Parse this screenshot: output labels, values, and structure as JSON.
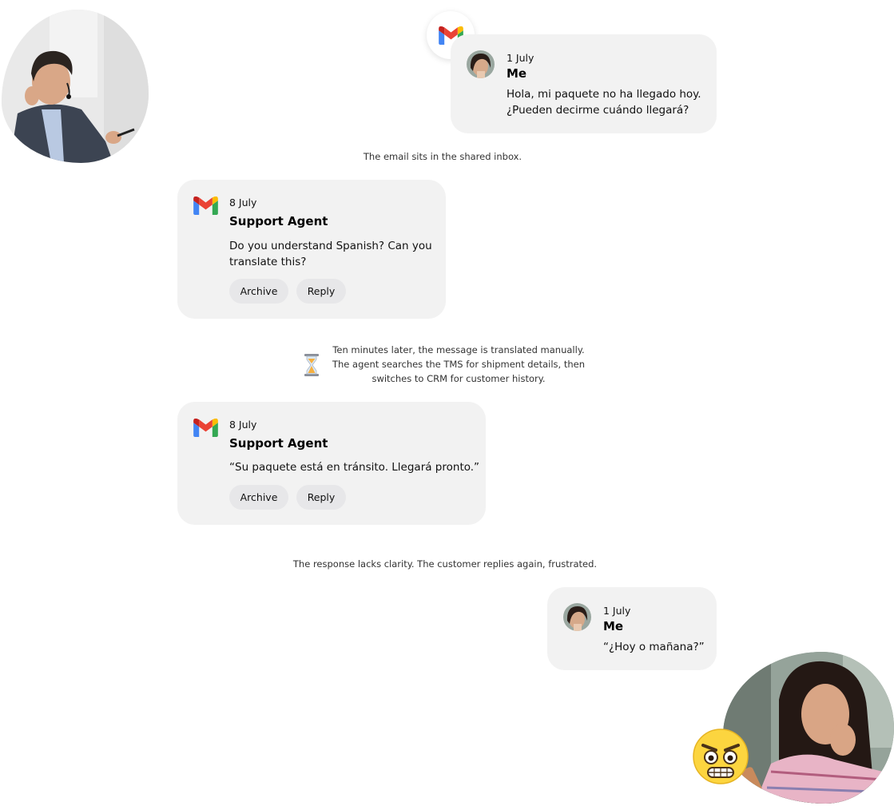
{
  "messages": [
    {
      "date": "1 July",
      "sender": "Me",
      "text": "Hola, mi paquete no ha llegado hoy. ¿Pueden decirme cuándo llegará?"
    },
    {
      "date": "8 July",
      "sender": "Support Agent",
      "text": "Do you understand Spanish? Can you translate this?",
      "archive_label": "Archive",
      "reply_label": "Reply"
    },
    {
      "date": "8 July",
      "sender": "Support Agent",
      "text": "“Su paquete está en tránsito. Llegará pronto.”",
      "archive_label": "Archive",
      "reply_label": "Reply"
    },
    {
      "date": "1 July",
      "sender": "Me",
      "text": "“¿Hoy o mañana?”"
    }
  ],
  "captions": {
    "inbox": "The email sits in the shared inbox.",
    "translated": "Ten minutes later, the message is translated manually. The agent searches the TMS for shipment details, then switches to CRM for customer history.",
    "clarity": "The response lacks clarity. The customer replies again, frustrated."
  },
  "icons": {
    "email_logo": "gmail-icon",
    "timer": "hourglass-icon",
    "frustration": "angry-face-emoji"
  },
  "colors": {
    "card_bg": "#f2f2f2",
    "button_bg": "#e7e7e9",
    "gmail_red": "#ea4335",
    "gmail_blue": "#4285f4",
    "gmail_green": "#34a853",
    "gmail_yellow": "#fbbc04"
  }
}
